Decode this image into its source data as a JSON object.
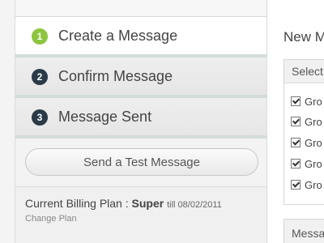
{
  "steps": [
    {
      "number": "1",
      "label": "Create a Message",
      "active": true
    },
    {
      "number": "2",
      "label": "Confirm Message",
      "active": false
    },
    {
      "number": "3",
      "label": "Message Sent",
      "active": false
    }
  ],
  "test_button_label": "Send a Test Message",
  "billing": {
    "prefix": "Current Billing Plan : ",
    "plan": "Super",
    "till": "till 08/02/2011",
    "change_link": "Change Plan"
  },
  "right_panel": {
    "title": "New M",
    "select_header": "Select",
    "groups": [
      "Gro",
      "Gro",
      "Gro",
      "Gro",
      "Gro"
    ],
    "message_header": "Messa"
  },
  "colors": {
    "active_step": "#8cc63f",
    "inactive_step": "#2a3a47"
  }
}
